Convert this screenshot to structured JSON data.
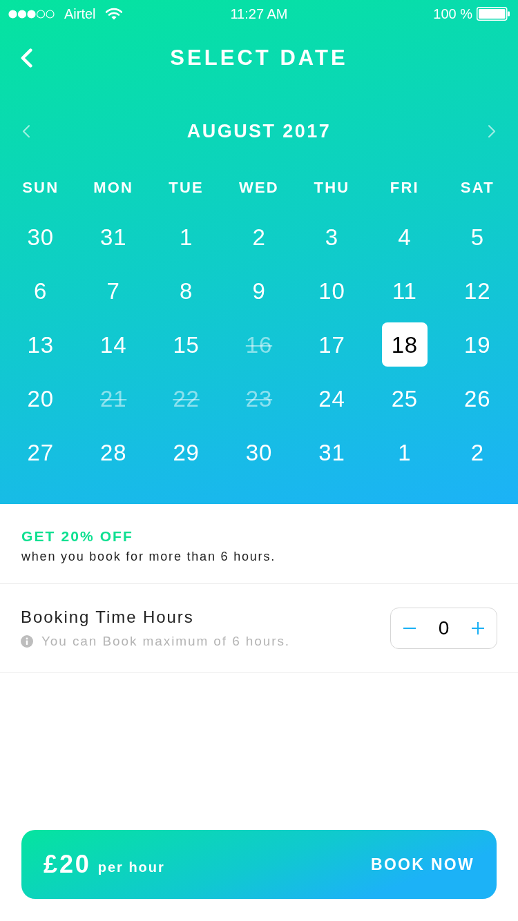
{
  "status_bar": {
    "carrier": "Airtel",
    "time": "11:27 AM",
    "battery": "100 %"
  },
  "header": {
    "title": "SELECT DATE"
  },
  "calendar": {
    "month": "AUGUST 2017",
    "weekdays": [
      "SUN",
      "MON",
      "TUE",
      "WED",
      "THU",
      "FRI",
      "SAT"
    ],
    "days": [
      {
        "label": "30",
        "selected": false,
        "unavailable": false
      },
      {
        "label": "31",
        "selected": false,
        "unavailable": false
      },
      {
        "label": "1",
        "selected": false,
        "unavailable": false
      },
      {
        "label": "2",
        "selected": false,
        "unavailable": false
      },
      {
        "label": "3",
        "selected": false,
        "unavailable": false
      },
      {
        "label": "4",
        "selected": false,
        "unavailable": false
      },
      {
        "label": "5",
        "selected": false,
        "unavailable": false
      },
      {
        "label": "6",
        "selected": false,
        "unavailable": false
      },
      {
        "label": "7",
        "selected": false,
        "unavailable": false
      },
      {
        "label": "8",
        "selected": false,
        "unavailable": false
      },
      {
        "label": "9",
        "selected": false,
        "unavailable": false
      },
      {
        "label": "10",
        "selected": false,
        "unavailable": false
      },
      {
        "label": "11",
        "selected": false,
        "unavailable": false
      },
      {
        "label": "12",
        "selected": false,
        "unavailable": false
      },
      {
        "label": "13",
        "selected": false,
        "unavailable": false
      },
      {
        "label": "14",
        "selected": false,
        "unavailable": false
      },
      {
        "label": "15",
        "selected": false,
        "unavailable": false
      },
      {
        "label": "16",
        "selected": false,
        "unavailable": true
      },
      {
        "label": "17",
        "selected": false,
        "unavailable": false
      },
      {
        "label": "18",
        "selected": true,
        "unavailable": false
      },
      {
        "label": "19",
        "selected": false,
        "unavailable": false
      },
      {
        "label": "20",
        "selected": false,
        "unavailable": false
      },
      {
        "label": "21",
        "selected": false,
        "unavailable": true
      },
      {
        "label": "22",
        "selected": false,
        "unavailable": true
      },
      {
        "label": "23",
        "selected": false,
        "unavailable": true
      },
      {
        "label": "24",
        "selected": false,
        "unavailable": false
      },
      {
        "label": "25",
        "selected": false,
        "unavailable": false
      },
      {
        "label": "26",
        "selected": false,
        "unavailable": false
      },
      {
        "label": "27",
        "selected": false,
        "unavailable": false
      },
      {
        "label": "28",
        "selected": false,
        "unavailable": false
      },
      {
        "label": "29",
        "selected": false,
        "unavailable": false
      },
      {
        "label": "30",
        "selected": false,
        "unavailable": false
      },
      {
        "label": "31",
        "selected": false,
        "unavailable": false
      },
      {
        "label": "1",
        "selected": false,
        "unavailable": false
      },
      {
        "label": "2",
        "selected": false,
        "unavailable": false
      }
    ]
  },
  "offer": {
    "title": "GET 20% OFF",
    "text": "when you book for more than 6 hours."
  },
  "booking_hours": {
    "label": "Booking Time Hours",
    "hint": "You can Book maximum of 6 hours.",
    "value": "0"
  },
  "book_bar": {
    "price": "£20",
    "unit": "per hour",
    "button": "BOOK NOW"
  }
}
